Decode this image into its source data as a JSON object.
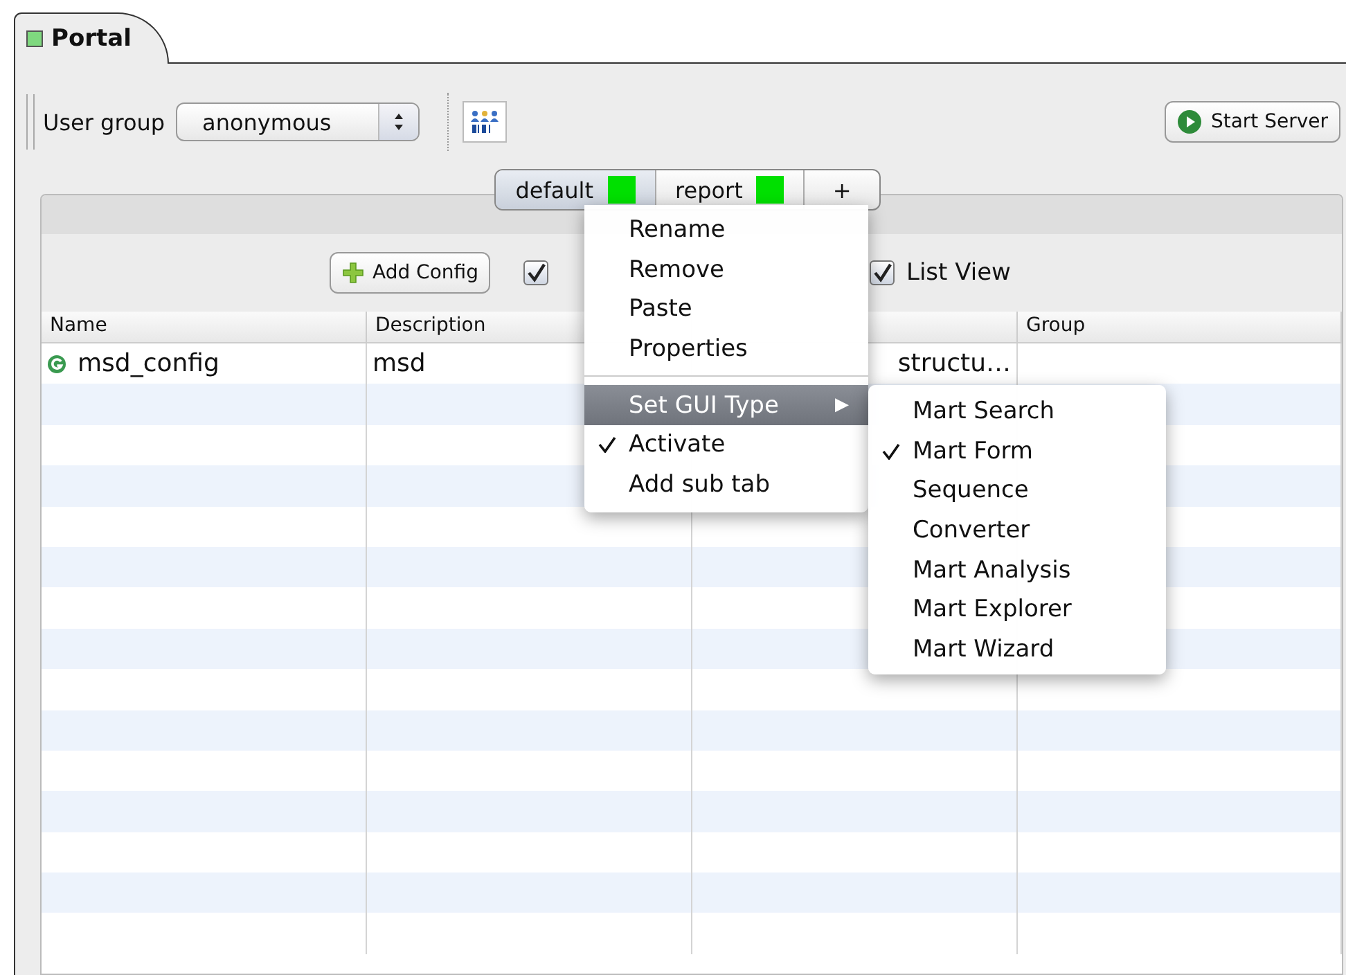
{
  "main_tab": {
    "label": "Portal",
    "on": true
  },
  "toolbar": {
    "user_group_label": "User group",
    "user_group_value": "anonymous",
    "start_button": "Start Server"
  },
  "sub_tabs": [
    {
      "label": "default",
      "selected": true,
      "active": true
    },
    {
      "label": "report",
      "selected": false,
      "active": true
    },
    {
      "label": "+",
      "selected": false
    }
  ],
  "actions": {
    "add_button": "Add Config",
    "hidden_checkbox": {
      "checked": true
    },
    "list_view": {
      "label": "List View",
      "checked": true
    }
  },
  "table": {
    "columns": [
      {
        "label": "Name"
      },
      {
        "label": "Description"
      },
      {},
      {
        "label": "Group"
      }
    ],
    "rows": [
      {
        "cells": [
          "msd_config",
          "msd",
          "structu…",
          ""
        ]
      }
    ]
  },
  "context_menu": {
    "items": [
      {
        "kind": "item",
        "label": "Rename",
        "selected": false,
        "checked": false
      },
      {
        "kind": "item",
        "label": "Remove",
        "selected": false,
        "checked": false
      },
      {
        "kind": "item",
        "label": "Paste",
        "selected": false,
        "checked": false
      },
      {
        "kind": "item",
        "label": "Properties",
        "selected": false,
        "checked": false
      },
      {
        "kind": "separator"
      },
      {
        "kind": "submenu",
        "label": "Set GUI Type",
        "arrow": "▶",
        "selected": true,
        "checked": false
      },
      {
        "kind": "item",
        "label": "Activate",
        "selected": false,
        "checked": true
      },
      {
        "kind": "item",
        "label": "Add sub tab",
        "selected": false,
        "checked": false
      }
    ],
    "submenu": [
      {
        "label": "Mart Search",
        "checked": false
      },
      {
        "label": "Mart Form",
        "checked": true
      },
      {
        "label": "Sequence",
        "checked": false
      },
      {
        "label": "Converter",
        "checked": false
      },
      {
        "label": "Mart Analysis",
        "checked": false
      },
      {
        "label": "Mart Explorer",
        "checked": false
      },
      {
        "label": "Mart Wizard",
        "checked": false
      }
    ]
  }
}
